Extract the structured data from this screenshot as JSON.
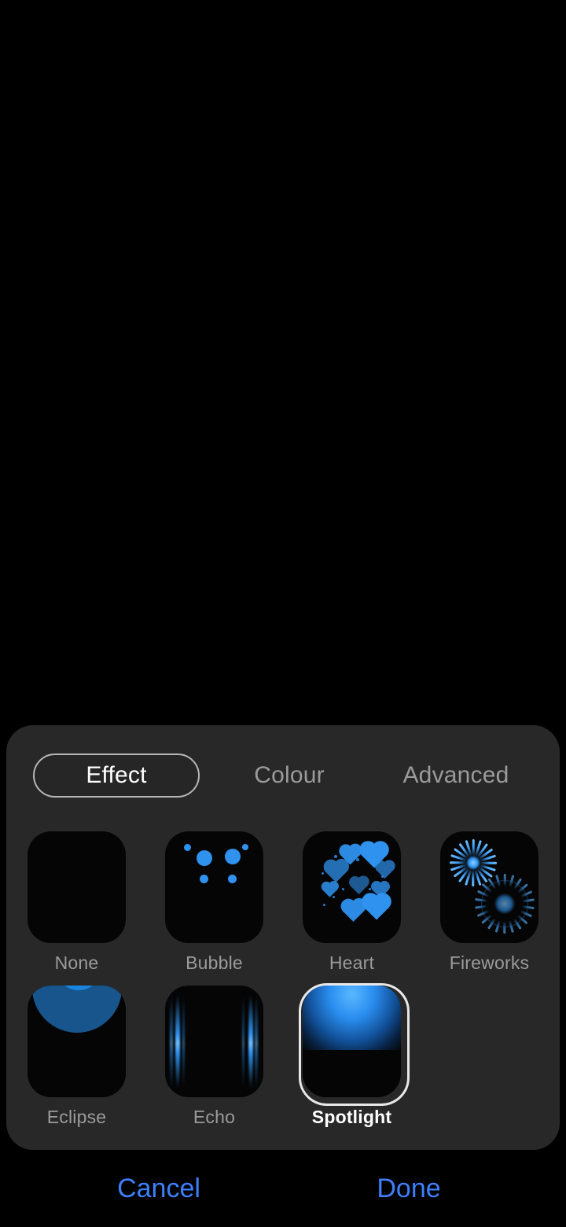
{
  "panel": {
    "tabs": [
      {
        "id": "effect",
        "label": "Effect",
        "selected": true
      },
      {
        "id": "colour",
        "label": "Colour",
        "selected": false
      },
      {
        "id": "advanced",
        "label": "Advanced",
        "selected": false
      }
    ],
    "effects": [
      {
        "id": "none",
        "label": "None",
        "selected": false
      },
      {
        "id": "bubble",
        "label": "Bubble",
        "selected": false
      },
      {
        "id": "heart",
        "label": "Heart",
        "selected": false
      },
      {
        "id": "fireworks",
        "label": "Fireworks",
        "selected": false
      },
      {
        "id": "eclipse",
        "label": "Eclipse",
        "selected": false
      },
      {
        "id": "echo",
        "label": "Echo",
        "selected": false
      },
      {
        "id": "spotlight",
        "label": "Spotlight",
        "selected": true
      }
    ]
  },
  "footer": {
    "cancel_label": "Cancel",
    "done_label": "Done"
  },
  "colors": {
    "accent_blue": "#3d7ffb",
    "effect_blue": "#2f92ef",
    "panel_bg": "#282828",
    "screen_bg": "#000000",
    "label_unselected": "#9b9b9b",
    "label_selected": "#ffffff"
  }
}
